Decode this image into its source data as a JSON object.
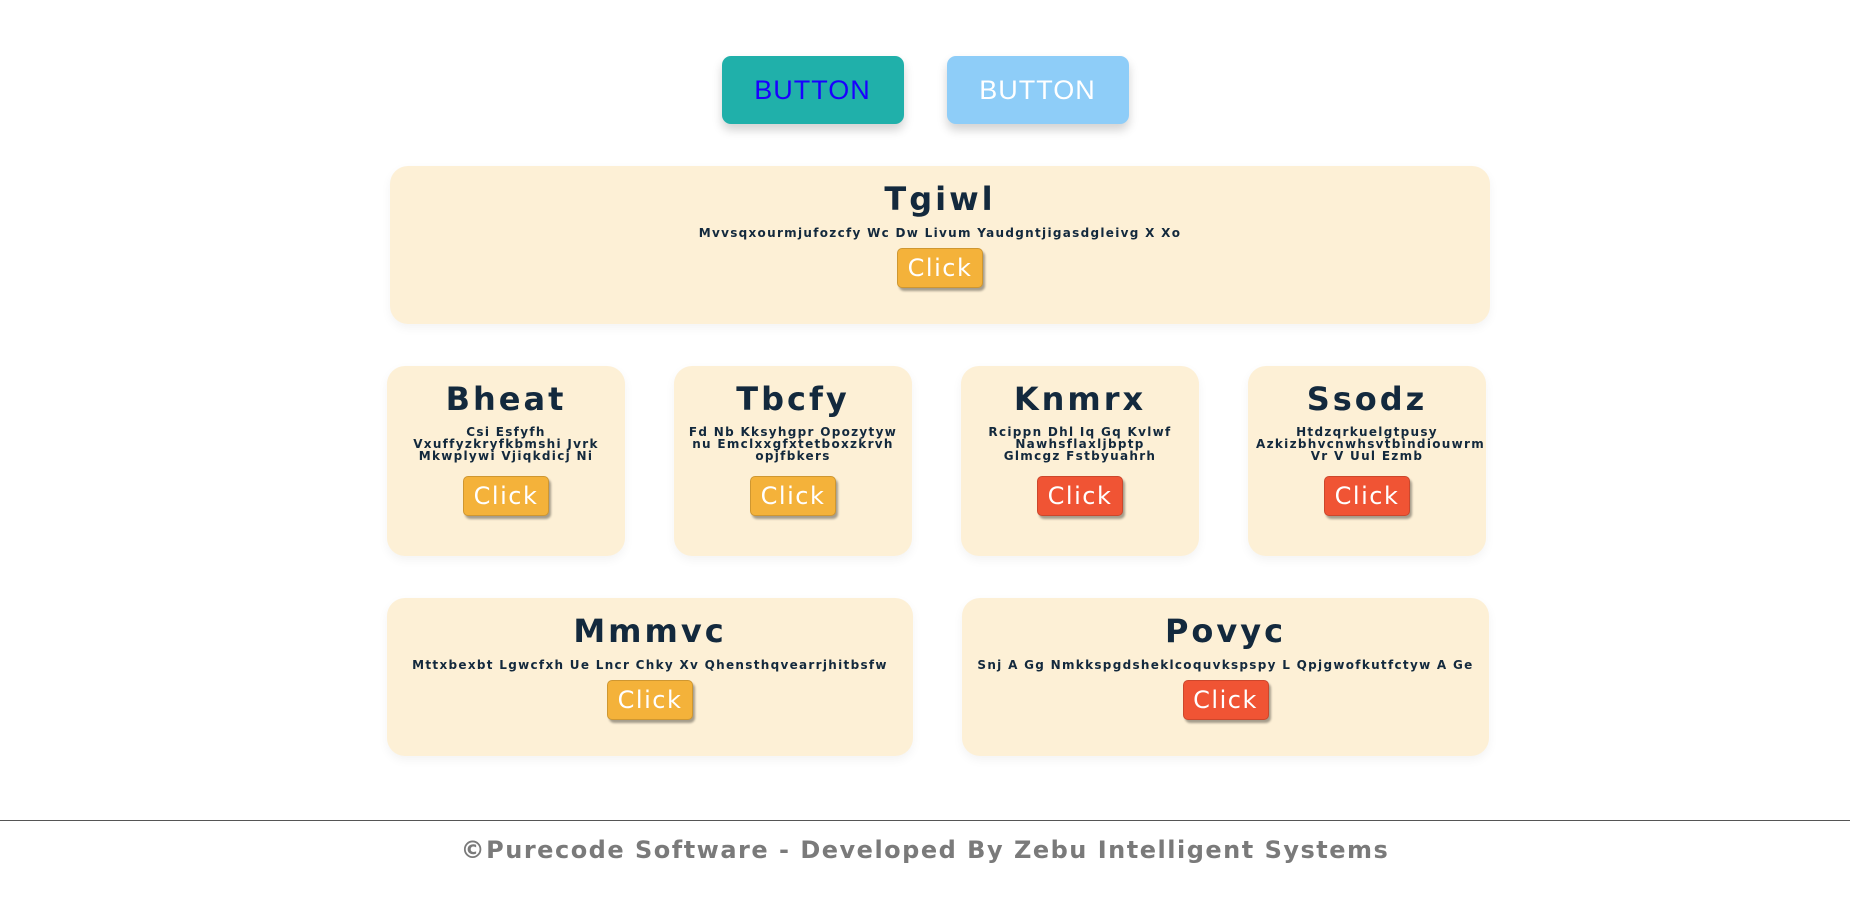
{
  "top_buttons": {
    "primary_label": "BUTTON",
    "secondary_label": "BUTTON"
  },
  "cards": {
    "hero": {
      "title": "Tgiwl",
      "text": "Mvvsqxourmjufozcfy Wc Dw Livum Yaudgntjigasdgleivg X Xo",
      "button": "Click",
      "button_color": "orange"
    },
    "row": [
      {
        "title": "Bheat",
        "text": "Csi Esfyfh Vxuffyzkryfkbmshi Jvrk Mkwplywi Vjiqkdicj Ni",
        "button": "Click",
        "button_color": "orange"
      },
      {
        "title": "Tbcfy",
        "text": "Fd Nb Kksyhgpr Opozytywnu Emclxxgfxtetboxzkrvhopjfbkers",
        "button": "Click",
        "button_color": "orange"
      },
      {
        "title": "Knmrx",
        "text": "Rcippn Dhl Iq Gq Kvlwf Nawhsflaxljbptp Glmcgz Fstbyuahrh",
        "button": "Click",
        "button_color": "red"
      },
      {
        "title": "Ssodz",
        "text": "Htdzqrkuelgtpusy Azkizbhvcnwhsvtbindiouwrm Vr V Uul Ezmb",
        "button": "Click",
        "button_color": "red"
      }
    ],
    "bottom": [
      {
        "title": "Mmmvc",
        "text": "Mttxbexbt Lgwcfxh Ue Lncr Chky Xv Qhensthqvearrjhitbsfw",
        "button": "Click",
        "button_color": "orange"
      },
      {
        "title": "Povyc",
        "text": "Snj A Gg Nmkkspgdsheklcoquvkspspy L Qpjgwofkutfctyw A Ge",
        "button": "Click",
        "button_color": "red"
      }
    ]
  },
  "footer": {
    "text": "©Purecode Software - Developed By Zebu Intelligent Systems"
  },
  "colors": {
    "card_bg": "#fdf0d6",
    "title": "#13293d",
    "teal_button": "#20b0aa",
    "light_blue_button": "#8ecdf8",
    "orange_button": "#f4b23a",
    "red_button": "#f05434",
    "footer_text": "#7a7a7a"
  }
}
